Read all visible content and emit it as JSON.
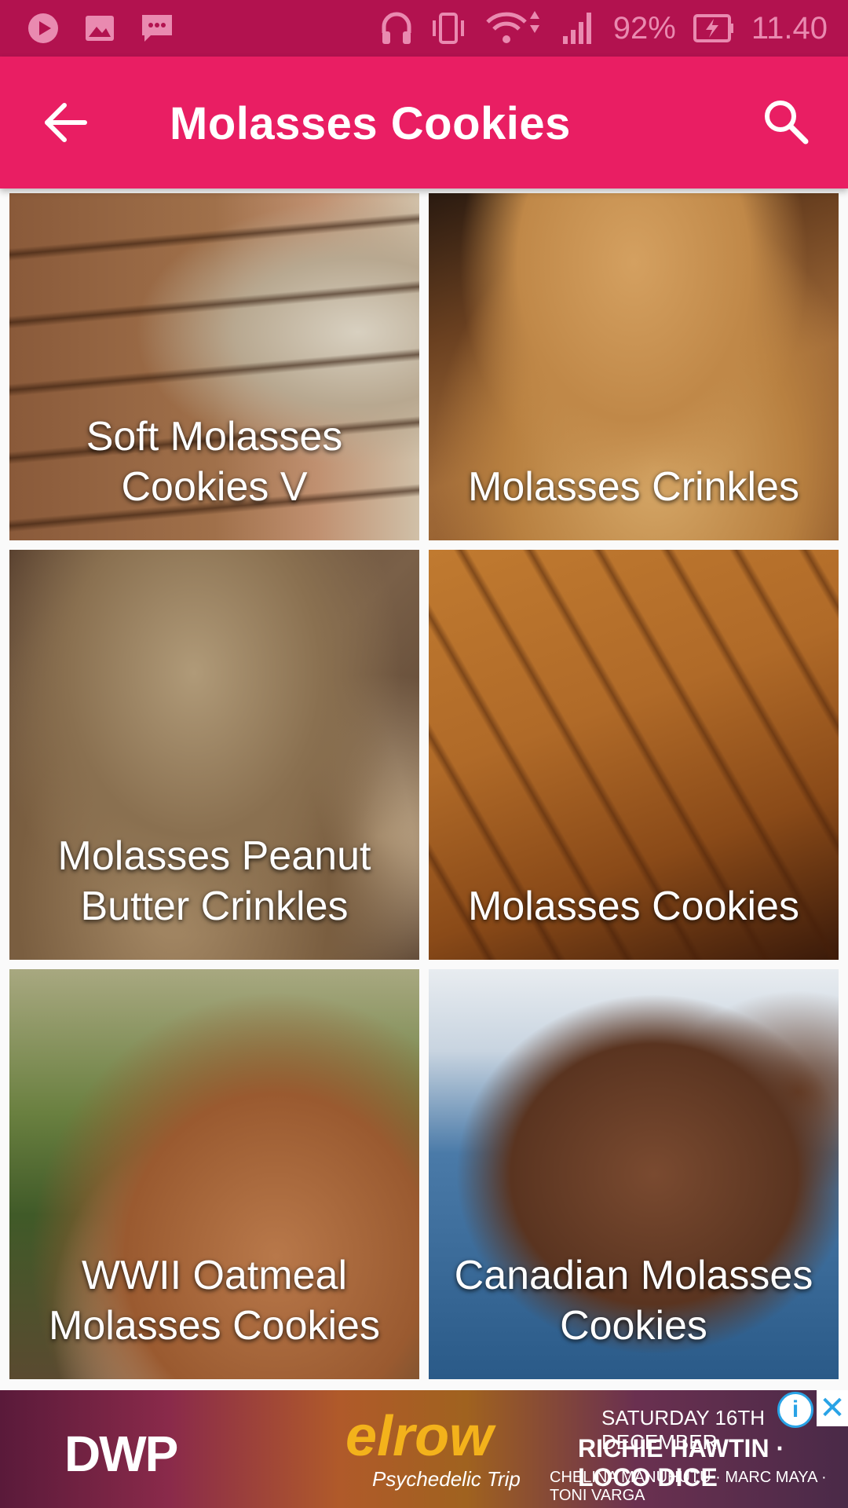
{
  "status_bar": {
    "battery_percent": "92%",
    "time": "11.40",
    "icons": [
      "play-icon",
      "image-icon",
      "message-icon",
      "headphones-icon",
      "vibrate-icon",
      "wifi-icon",
      "signal-icon",
      "battery-charging-icon"
    ]
  },
  "app_bar": {
    "title": "Molasses Cookies",
    "back_icon": "arrow-back-icon",
    "search_icon": "search-icon"
  },
  "recipes": [
    {
      "title": "Soft Molasses Cookies V"
    },
    {
      "title": "Molasses Crinkles"
    },
    {
      "title": "Molasses Peanut Butter Crinkles"
    },
    {
      "title": "Molasses Cookies"
    },
    {
      "title": "WWII Oatmeal Molasses Cookies"
    },
    {
      "title": "Canadian Molasses Cookies"
    }
  ],
  "ad": {
    "brand_left": "DWP",
    "brand_main": "elrow",
    "brand_sub": "Psychedelic Trip",
    "line1": "SATURDAY 16TH DECEMBER",
    "line2": "RICHIE HAWTIN · LOCO DICE",
    "line3": "CHELINA MANUHUTU · MARC MAYA · TONI VARGA",
    "info_symbol": "i",
    "close_symbol": "✕"
  },
  "colors": {
    "primary": "#e91e63",
    "status_bar": "#b2124f",
    "ad_icon": "#29a3e6"
  }
}
